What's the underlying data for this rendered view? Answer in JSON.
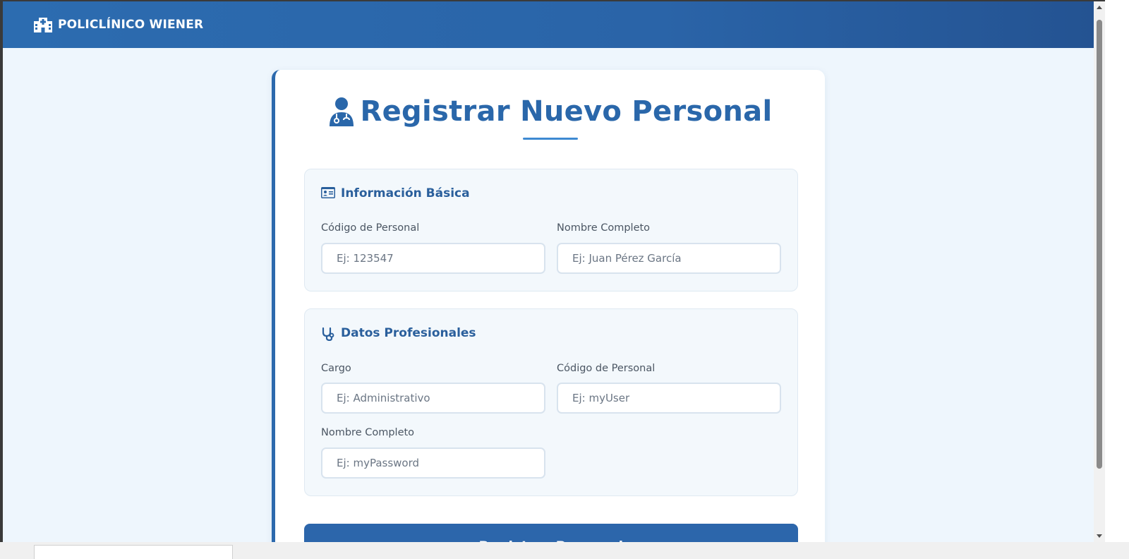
{
  "header": {
    "brand_icon": "hospital-icon",
    "brand": "POLICLÍNICO WIENER"
  },
  "form": {
    "title_icon": "user-doctor-icon",
    "title": "Registrar Nuevo Personal",
    "sections": [
      {
        "icon": "id-card-icon",
        "title": "Información Básica",
        "fields": [
          {
            "label": "Código de Personal",
            "placeholder": "Ej: 123547"
          },
          {
            "label": "Nombre Completo",
            "placeholder": "Ej: Juan Pérez García"
          }
        ]
      },
      {
        "icon": "stethoscope-icon",
        "title": "Datos Profesionales",
        "fields": [
          {
            "label": "Cargo",
            "placeholder": "Ej: Administrativo"
          },
          {
            "label": "Código de Personal",
            "placeholder": "Ej: myUser"
          },
          {
            "label": "Nombre Completo",
            "placeholder": "Ej: myPassword"
          }
        ]
      }
    ],
    "submit_label": "Registrar Personal"
  },
  "colors": {
    "primary": "#2c6cb0",
    "title": "#2a67aa",
    "background": "#eef6fd",
    "section_bg": "#f3f8fc"
  }
}
